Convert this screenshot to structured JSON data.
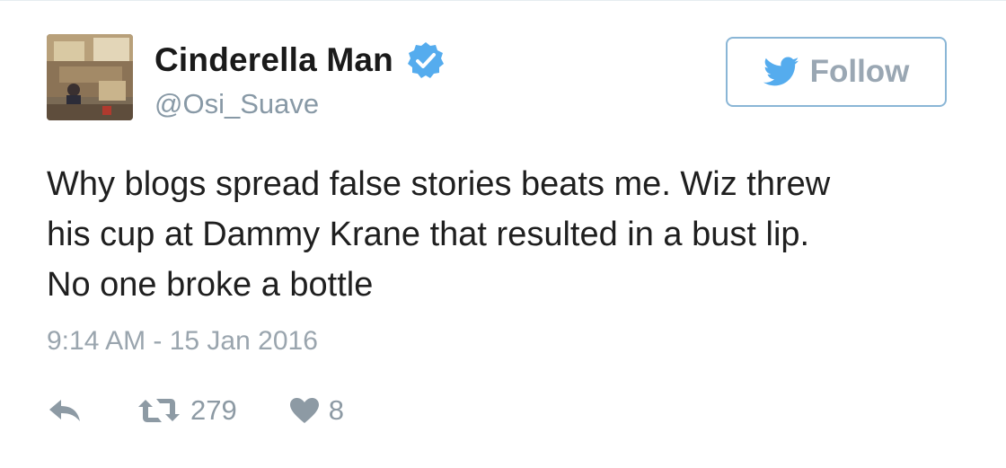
{
  "tweet": {
    "author": {
      "display_name": "Cinderella Man",
      "handle": "@Osi_Suave",
      "verified": true
    },
    "follow_button": {
      "label": "Follow",
      "icon": "twitter-bird-icon"
    },
    "text_lines": [
      "Why blogs spread false stories beats me. Wiz threw",
      "his cup at Dammy Krane that resulted in a bust lip.",
      "No one broke a bottle"
    ],
    "timestamp": "9:14 AM - 15 Jan 2016",
    "actions": {
      "reply": {
        "icon": "reply-icon"
      },
      "retweet": {
        "icon": "retweet-icon",
        "count": "279"
      },
      "like": {
        "icon": "heart-icon",
        "count": "8"
      }
    }
  },
  "colors": {
    "accent": "#55acee",
    "text": "#1f1f1f",
    "muted": "#9aa5ae",
    "verified_badge": "#55acee"
  }
}
